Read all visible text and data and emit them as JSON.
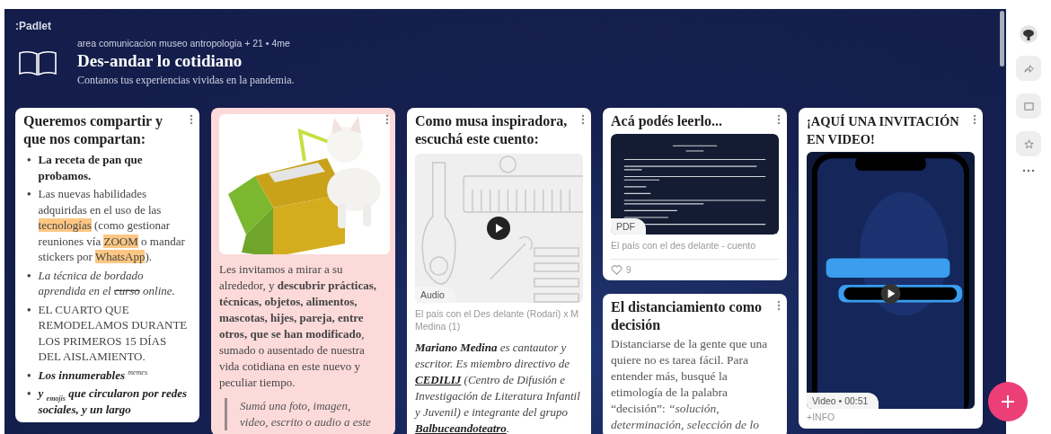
{
  "app": {
    "logo": ":Padlet"
  },
  "header": {
    "attribution": "area comunicacion museo antropologia + 21 • 4me",
    "title": "Des-andar lo cotidiano",
    "subtitle": "Contanos tus experiencias vividas en la pandemia."
  },
  "columns": [
    {
      "cards": [
        {
          "kind": "list",
          "color": "#ffffff",
          "title": "Queremos compartir y que nos compartan:",
          "items": [
            {
              "bullet": "•",
              "segments": [
                {
                  "text": "La receta de pan que probamos.",
                  "kind": "bold"
                }
              ]
            },
            {
              "bullet": "•",
              "segments": [
                {
                  "text": "Las nuevas habilidades adquiridas en el uso de las ",
                  "kind": "plain"
                },
                {
                  "text": "tecnologías",
                  "kind": "highlight"
                },
                {
                  "text": " (como gestionar reuniones vía ",
                  "kind": "plain"
                },
                {
                  "text": "ZOOM",
                  "kind": "highlight"
                },
                {
                  "text": " o mandar stickers por ",
                  "kind": "plain"
                },
                {
                  "text": "WhatsApp",
                  "kind": "highlight"
                },
                {
                  "text": ").",
                  "kind": "plain"
                }
              ]
            },
            {
              "bullet": "•",
              "segments": [
                {
                  "text": "La técnica de bordado aprendida en el ",
                  "kind": "italic"
                },
                {
                  "text": "curso",
                  "kind": "strike"
                },
                {
                  "text": " online.",
                  "kind": "italic"
                }
              ]
            },
            {
              "bullet": "•",
              "segments": [
                {
                  "text": "EL CUARTO QUE REMODELAMOS DURANTE LOS PRIMEROS 15 DÍAS DEL AISLAMIENTO.",
                  "kind": "plain"
                }
              ]
            },
            {
              "bullet": "•",
              "segments": [
                {
                  "text": "Los innumerables ",
                  "kind": "bolditalic"
                },
                {
                  "text": "memes",
                  "kind": "sup"
                }
              ]
            },
            {
              "bullet": "•",
              "segments": [
                {
                  "text": "y ",
                  "kind": "bolditalic"
                },
                {
                  "text": "emojis",
                  "kind": "sub"
                },
                {
                  "text": " que circularon por redes sociales, y un largo",
                  "kind": "bolditalic"
                }
              ]
            }
          ]
        }
      ]
    },
    {
      "cards": [
        {
          "kind": "image_text",
          "color": "#fcdada",
          "body": "Les invitamos a mirar a su alrededor, y **descubrir prácticas, técnicas, objetos, alimentos, mascotas, hijes, pareja, entre otros, que se han modificado**, sumado o ausentado de nuestra vida cotidiana en este nuevo y peculiar tiempo.",
          "quote": "Sumá una foto, imagen, video, escrito o audio a este"
        }
      ]
    },
    {
      "cards": [
        {
          "kind": "audio",
          "color": "#ffffff",
          "title": "Como musa inspiradora, escuchá este cuento:",
          "media_label": "Audio",
          "caption": "El pais con el Des delante (Rodari) x M Medina (1)",
          "segments": [
            {
              "text": "Mariano Medina",
              "kind": "bolditalic"
            },
            {
              "text": " es cantautor y escritor. Es miembro directivo de ",
              "kind": "italic"
            },
            {
              "text": "CEDILIJ",
              "kind": "link"
            },
            {
              "text": " (Centro de Difusión e Investigación de Literatura Infantil y Juvenil) e integrante del grupo ",
              "kind": "italic"
            },
            {
              "text": "Balbuceandoteatro",
              "kind": "link"
            },
            {
              "text": ".",
              "kind": "italic"
            }
          ]
        }
      ]
    },
    {
      "cards": [
        {
          "kind": "pdf",
          "color": "#ffffff",
          "title": "Acá podés leerlo...",
          "media_label": "PDF",
          "caption": "El país con el des delante - cuento",
          "likes": "9"
        },
        {
          "kind": "text",
          "color": "#ffffff",
          "title": "El distanciamiento como decisión",
          "body": "Distanciarse de la gente que una quiere no es tarea fácil. Para entender más, busqué la etimología de la palabra “decisión”: *“solución, determinación, selección de lo*"
        }
      ]
    },
    {
      "cards": [
        {
          "kind": "video",
          "color": "#ffffff",
          "title": "¡AQUÍ UNA INVITACIÓN EN VIDEO!",
          "media_label": "Video • 00:51",
          "footer": "+INFO"
        }
      ]
    }
  ]
}
